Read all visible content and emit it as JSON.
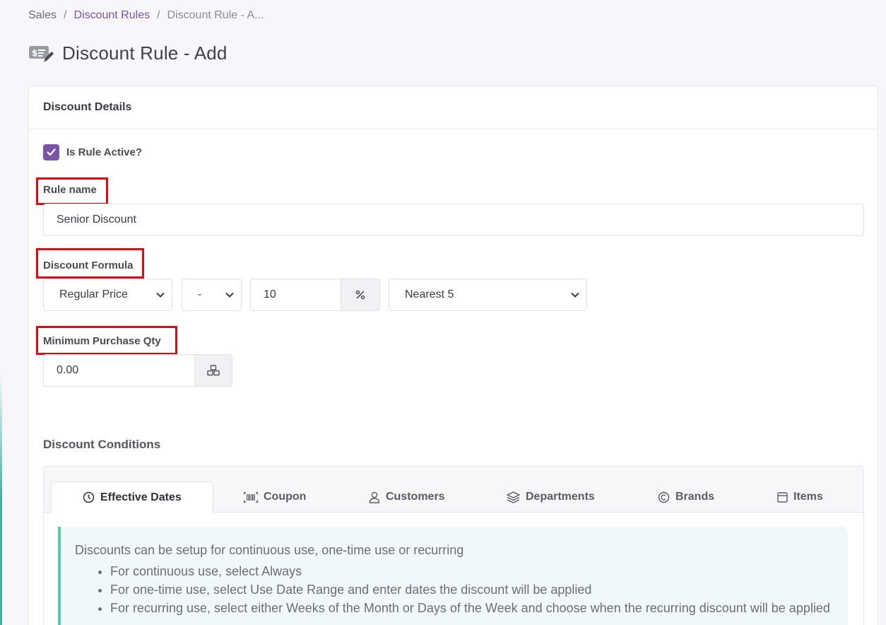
{
  "breadcrumb": {
    "items": [
      "Sales",
      "Discount Rules",
      "Discount Rule - A..."
    ],
    "separator": "/"
  },
  "page": {
    "title": "Discount Rule - Add",
    "icon": "discount-tag-edit-icon"
  },
  "card": {
    "header": "Discount Details"
  },
  "form": {
    "is_active": {
      "label": "Is Rule Active?",
      "checked": true
    },
    "rule_name": {
      "label": "Rule name",
      "value": "Senior Discount"
    },
    "discount_formula": {
      "label": "Discount Formula",
      "price_base": "Regular Price",
      "operator": "-",
      "amount": "10",
      "amount_unit_icon": "percent-icon",
      "rounding": "Nearest 5"
    },
    "min_purchase_qty": {
      "label": "Minimum Purchase Qty",
      "value": "0.00",
      "addon_icon": "boxes-icon"
    }
  },
  "conditions": {
    "title": "Discount Conditions",
    "tabs": [
      {
        "label": "Effective Dates",
        "icon": "clock-icon",
        "active": true
      },
      {
        "label": "Coupon",
        "icon": "barcode-icon",
        "active": false
      },
      {
        "label": "Customers",
        "icon": "user-icon",
        "active": false
      },
      {
        "label": "Departments",
        "icon": "layers-icon",
        "active": false
      },
      {
        "label": "Brands",
        "icon": "copyright-icon",
        "active": false
      },
      {
        "label": "Items",
        "icon": "box-icon",
        "active": false
      }
    ],
    "info": {
      "intro": "Discounts can be setup for continuous use, one-time use or recurring",
      "bullets": [
        "For continuous use, select Always",
        "For one-time use, select Use Date Range and enter dates the discount will be applied",
        "For recurring use, select either Weeks of the Month or Days of the Week and choose when the recurring discount will be applied"
      ]
    }
  },
  "colors": {
    "accent": "#7a55a6",
    "highlight": "#e00a14",
    "callout_border": "#5fc9b2"
  }
}
